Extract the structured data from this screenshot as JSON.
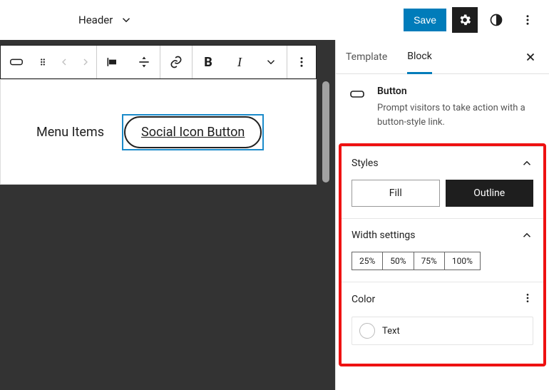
{
  "topbar": {
    "title": "Header",
    "save_label": "Save"
  },
  "canvas": {
    "menu_items_label": "Menu Items",
    "button_text": "Social Icon Button"
  },
  "sidebar": {
    "tabs": {
      "template": "Template",
      "block": "Block"
    },
    "block_info": {
      "name": "Button",
      "desc": "Prompt visitors to take action with a button-style link."
    },
    "styles": {
      "heading": "Styles",
      "fill": "Fill",
      "outline": "Outline",
      "selected": "Outline"
    },
    "width": {
      "heading": "Width settings",
      "options": [
        "25%",
        "50%",
        "75%",
        "100%"
      ]
    },
    "color": {
      "heading": "Color",
      "text_label": "Text"
    }
  }
}
